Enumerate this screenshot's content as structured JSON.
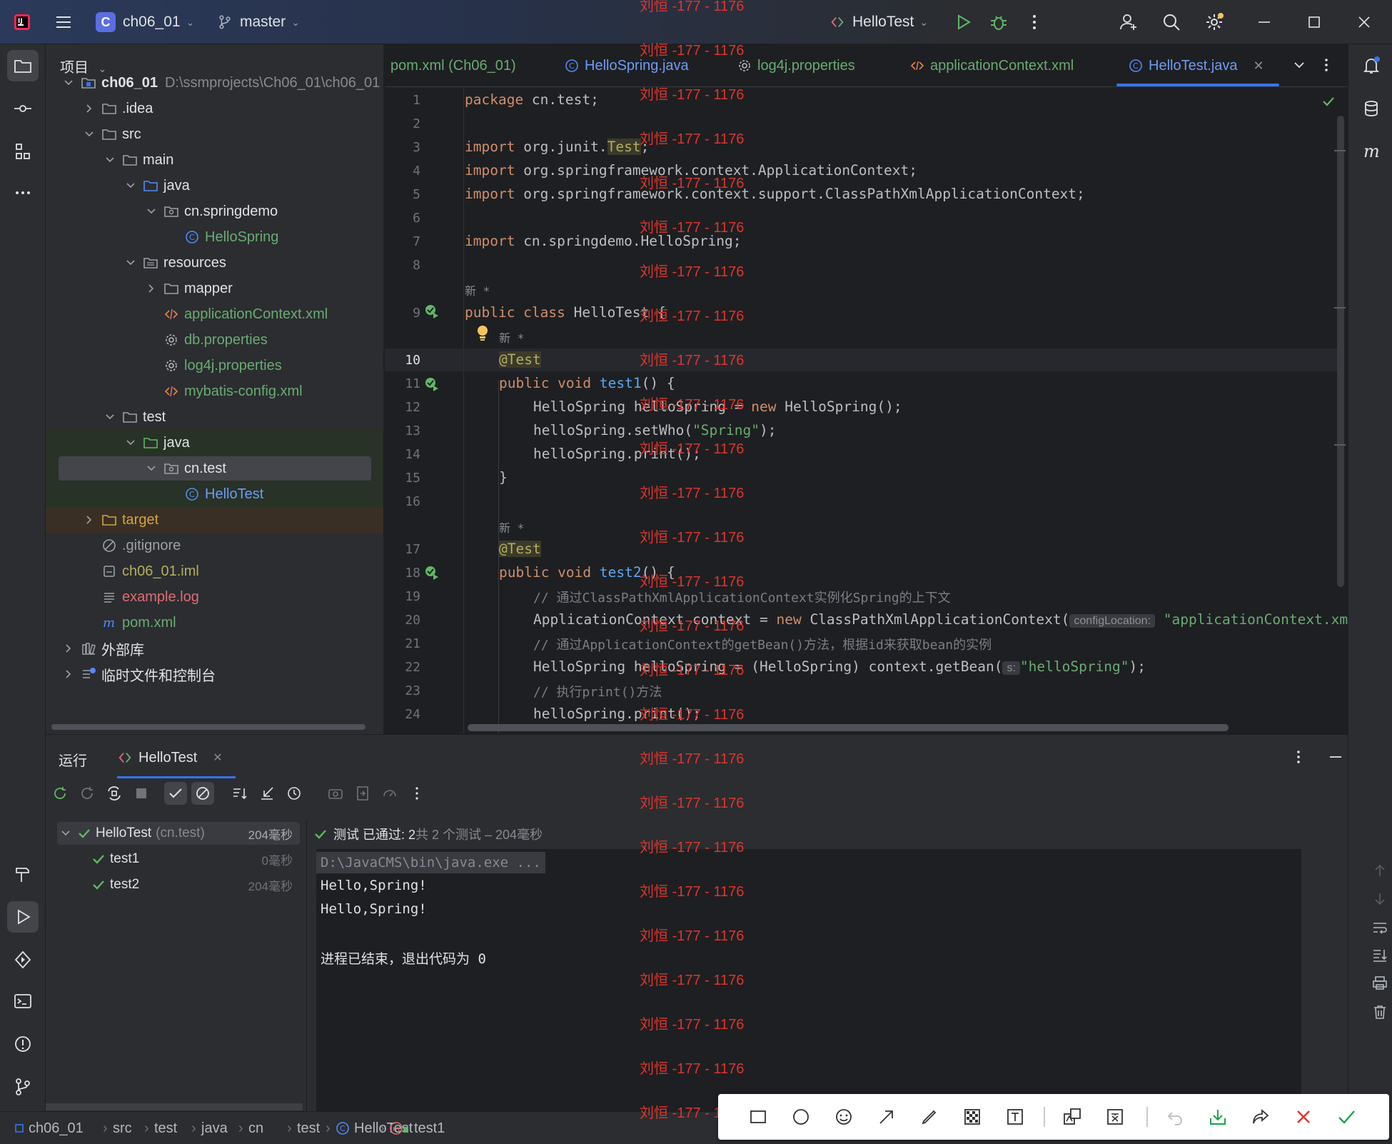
{
  "titlebar": {
    "project_letter": "C",
    "project_name": "ch06_01",
    "branch": "master",
    "run_config": "HelloTest"
  },
  "project_panel": {
    "title": "项目",
    "root_name": "ch06_01",
    "root_path": "D:\\ssmprojects\\Ch06_01\\ch06_01",
    "items": [
      {
        "label": ".idea"
      },
      {
        "label": "src"
      },
      {
        "label": "main"
      },
      {
        "label": "java"
      },
      {
        "label": "cn.springdemo"
      },
      {
        "label": "HelloSpring"
      },
      {
        "label": "resources"
      },
      {
        "label": "mapper"
      },
      {
        "label": "applicationContext.xml"
      },
      {
        "label": "db.properties"
      },
      {
        "label": "log4j.properties"
      },
      {
        "label": "mybatis-config.xml"
      },
      {
        "label": "test"
      },
      {
        "label": "java"
      },
      {
        "label": "cn.test"
      },
      {
        "label": "HelloTest"
      },
      {
        "label": "target"
      },
      {
        "label": ".gitignore"
      },
      {
        "label": "ch06_01.iml"
      },
      {
        "label": "example.log"
      },
      {
        "label": "pom.xml"
      },
      {
        "label": "外部库"
      },
      {
        "label": "临时文件和控制台"
      }
    ]
  },
  "tabs": [
    {
      "label": "pom.xml (Ch06_01)"
    },
    {
      "label": "HelloSpring.java"
    },
    {
      "label": "log4j.properties"
    },
    {
      "label": "applicationContext.xml"
    },
    {
      "label": "HelloTest.java"
    }
  ],
  "editor": {
    "line_numbers": [
      "1",
      "2",
      "3",
      "4",
      "5",
      "6",
      "7",
      "8",
      "9",
      "10",
      "11",
      "12",
      "13",
      "14",
      "15",
      "16",
      "17",
      "18",
      "19",
      "20",
      "21",
      "22",
      "23",
      "24"
    ],
    "new_marker": "新 *",
    "lines": {
      "l1a": "package",
      "l1b": " cn.test;",
      "l3a": "import",
      "l3b": " org.junit.",
      "l3c": "Test",
      "l3d": ";",
      "l4a": "import",
      "l4b": " org.springframework.context.ApplicationContext;",
      "l5a": "import",
      "l5b": " org.springframework.context.support.ClassPathXmlApplicationContext;",
      "l7a": "import",
      "l7b": " cn.springdemo.HelloSpring;",
      "l9a": "public class",
      "l9b": " HelloTest {",
      "l10": "@Test",
      "l11a": "public void",
      "l11b": "test1",
      "l11c": "() {",
      "l12a": "HelloSpring helloSpring = ",
      "l12b": "new",
      "l12c": " HelloSpring();",
      "l13a": "helloSpring.setWho(",
      "l13b": "\"Spring\"",
      "l13c": ");",
      "l14": "helloSpring.print();",
      "l15": "}",
      "l17": "@Test",
      "l18a": "public void",
      "l18b": "test2",
      "l18c": "() {",
      "l19": "// 通过ClassPathXmlApplicationContext实例化Spring的上下文",
      "l20a": "ApplicationContext context = ",
      "l20b": "new",
      "l20c": " ClassPathXmlApplicationContext(",
      "l20hint": "configLocation:",
      "l20d": "\"applicationContext.xml\"",
      "l21": "// 通过ApplicationContext的getBean()方法，根据id来获取bean的实例",
      "l22a": "HelloSpring helloSpring = (HelloSpring) context.getBean(",
      "l22hint": "s:",
      "l22b": "\"helloSpring\"",
      "l22c": ");",
      "l23": "// 执行print()方法",
      "l24": "helloSpring.print();"
    }
  },
  "run_panel": {
    "tab_run": "运行",
    "tab_config": "HelloTest",
    "summary_passed": "测试 已通过: 2",
    "summary_total": "共 2 个测试 – 204毫秒",
    "tests": [
      {
        "name": "HelloTest",
        "pkg": "(cn.test)",
        "time": "204毫秒"
      },
      {
        "name": "test1",
        "time": "0毫秒"
      },
      {
        "name": "test2",
        "time": "204毫秒"
      }
    ],
    "console": [
      "D:\\JavaCMS\\bin\\java.exe ...",
      "Hello,Spring!",
      "Hello,Spring!",
      "",
      "进程已结束，退出代码为 0"
    ]
  },
  "statusbar": {
    "crumbs": [
      "ch06_01",
      "src",
      "test",
      "java",
      "cn",
      "test",
      "HelloTest",
      "test1"
    ]
  },
  "watermark": "刘恒 -177 - 1176"
}
